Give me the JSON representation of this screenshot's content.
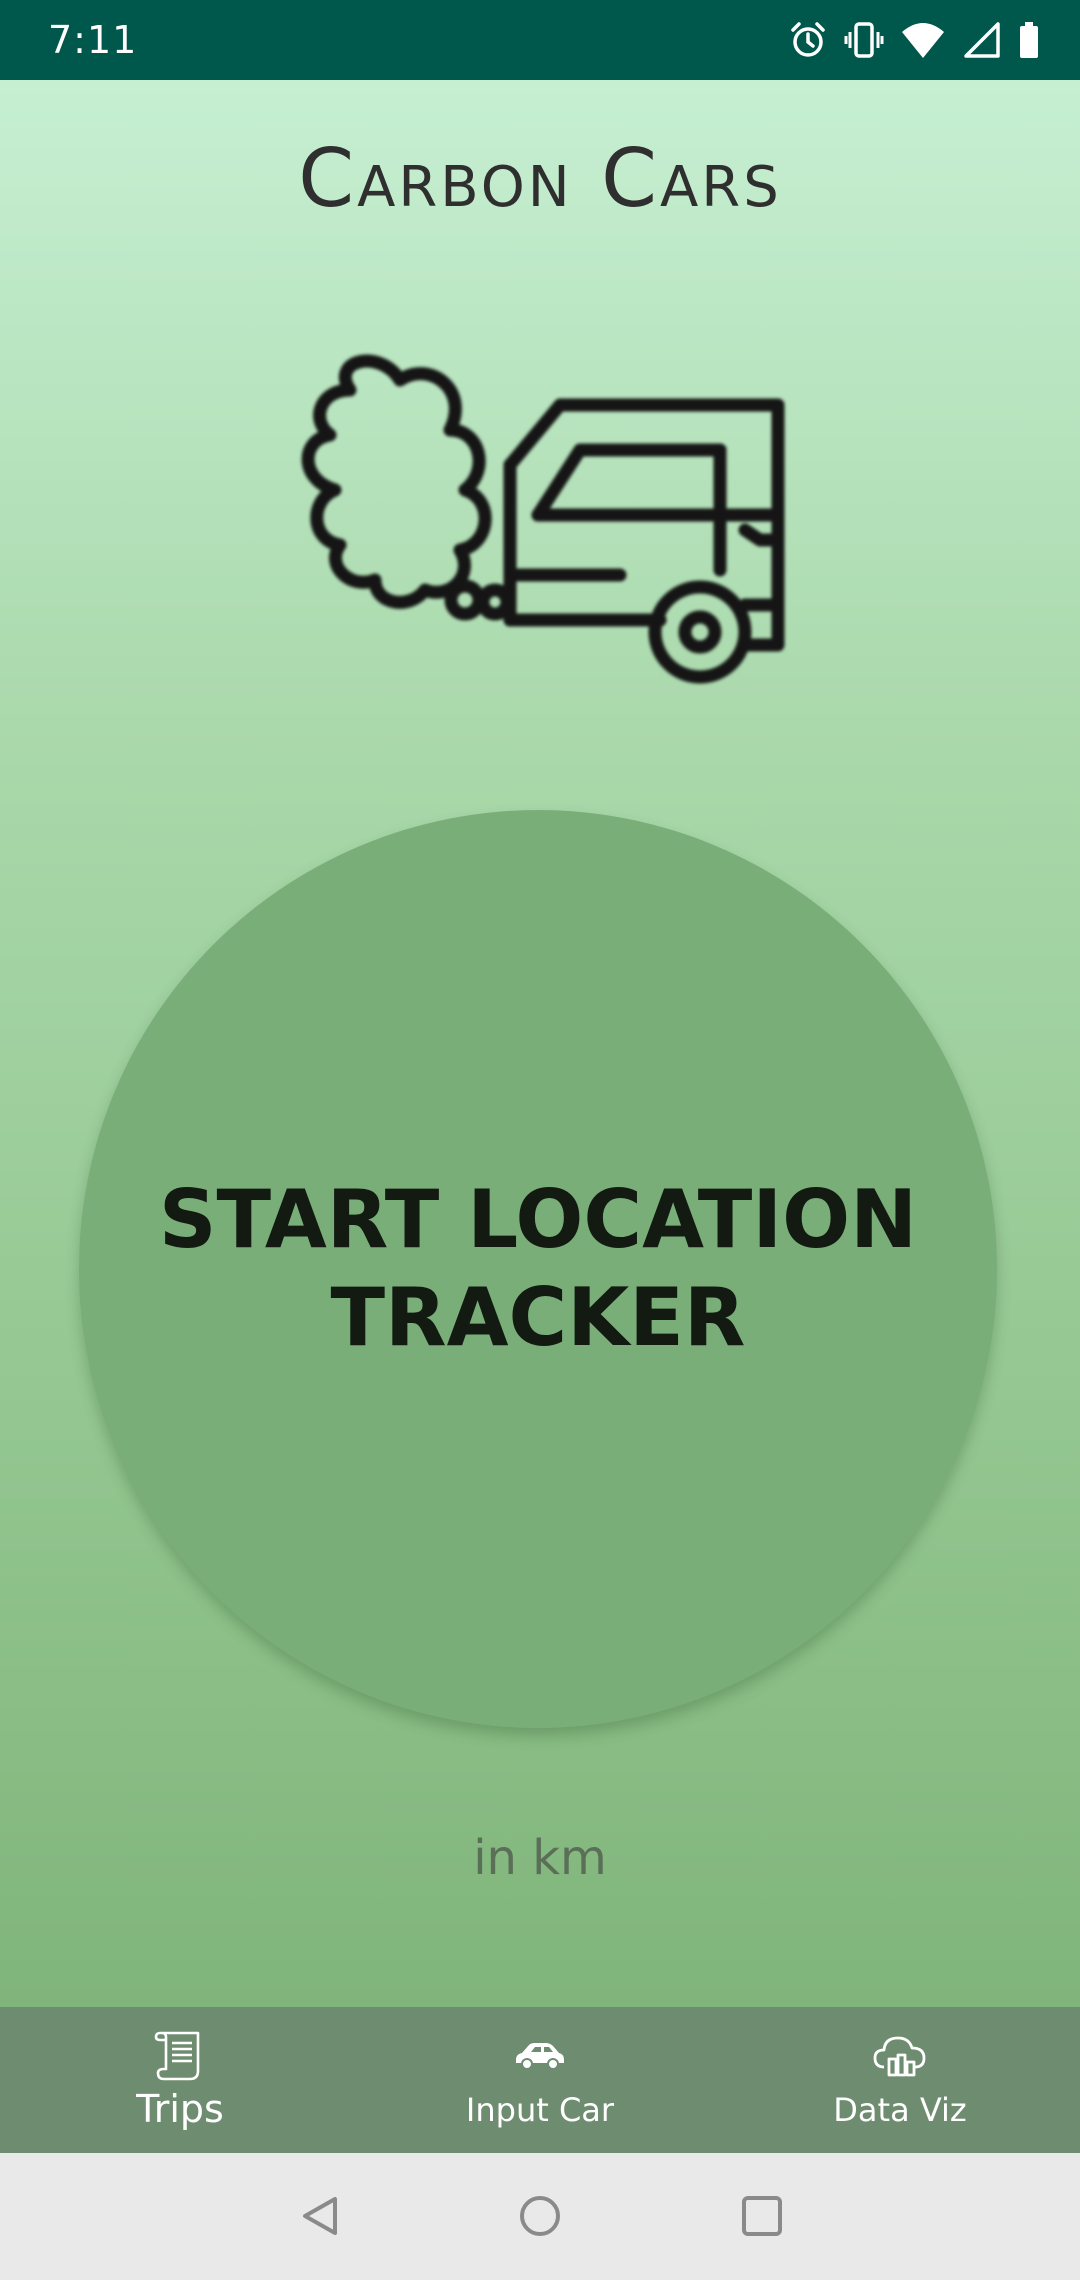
{
  "status_bar": {
    "time": "7:11",
    "icons": [
      "alarm-icon",
      "vibrate-icon",
      "wifi-icon",
      "cell-signal-icon",
      "battery-icon"
    ]
  },
  "app": {
    "title": "Carbon Cars",
    "hero_icon": "car-exhaust-icon"
  },
  "main": {
    "start_button_label": "START LOCATION TRACKER",
    "unit_label": "in km"
  },
  "bottom_nav": {
    "items": [
      {
        "label": "Trips",
        "icon": "scroll-icon",
        "active": true
      },
      {
        "label": "Input Car",
        "icon": "car-icon",
        "active": false
      },
      {
        "label": "Data Viz",
        "icon": "cloud-chart-icon",
        "active": false
      }
    ]
  },
  "system_nav": {
    "buttons": [
      "back-icon",
      "home-icon",
      "recents-icon"
    ]
  },
  "colors": {
    "status_bar": "#00574b",
    "button": "#7aae79",
    "nav_bar": "#6e8c6f"
  }
}
